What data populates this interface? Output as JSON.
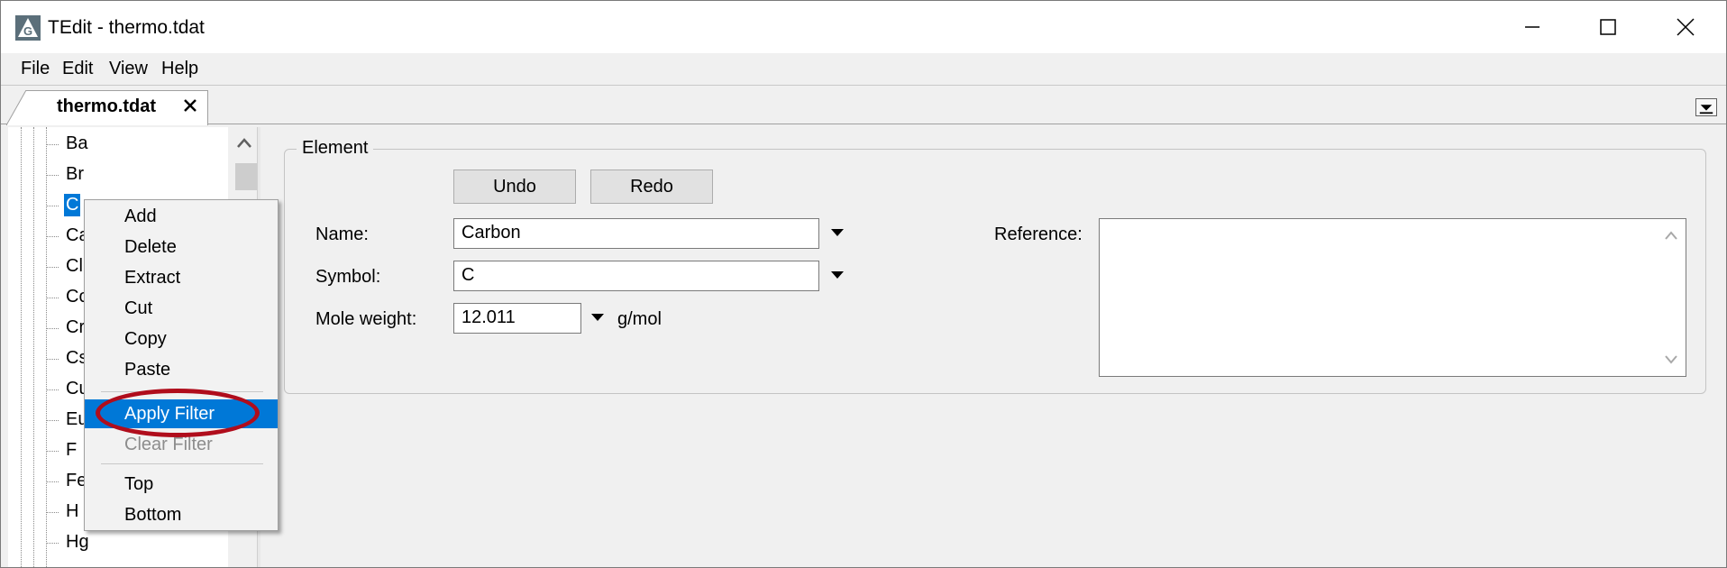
{
  "window": {
    "title": "TEdit - thermo.tdat",
    "app_icon": "tedit-logo-icon",
    "controls": [
      "minimize-icon",
      "maximize-icon",
      "close-icon"
    ]
  },
  "menubar": [
    "File",
    "Edit",
    "View",
    "Help"
  ],
  "tabs": [
    {
      "label": "thermo.tdat",
      "close_icon": "close-icon"
    }
  ],
  "tree": {
    "items": [
      "Ba",
      "Br",
      "C",
      "Ca",
      "Cl",
      "Co",
      "Cr",
      "Cs",
      "Cu",
      "Eu",
      "F",
      "Fe",
      "H",
      "Hg"
    ],
    "selected": "C"
  },
  "element_group": {
    "legend": "Element",
    "undo_label": "Undo",
    "redo_label": "Redo",
    "name_label": "Name:",
    "name_value": "Carbon",
    "symbol_label": "Symbol:",
    "symbol_value": "C",
    "mole_weight_label": "Mole weight:",
    "mole_weight_value": "12.011",
    "mole_weight_unit": "g/mol",
    "reference_label": "Reference:",
    "reference_value": ""
  },
  "context_menu": {
    "items": [
      {
        "label": "Add",
        "state": "normal"
      },
      {
        "label": "Delete",
        "state": "normal"
      },
      {
        "label": "Extract",
        "state": "normal"
      },
      {
        "label": "Cut",
        "state": "normal"
      },
      {
        "label": "Copy",
        "state": "normal"
      },
      {
        "label": "Paste",
        "state": "normal"
      },
      {
        "label": "Apply Filter",
        "state": "highlighted"
      },
      {
        "label": "Clear Filter",
        "state": "disabled"
      },
      {
        "label": "Top",
        "state": "normal"
      },
      {
        "label": "Bottom",
        "state": "normal"
      }
    ]
  },
  "colors": {
    "selection": "#0078d7",
    "annotation": "#b00d1c"
  }
}
